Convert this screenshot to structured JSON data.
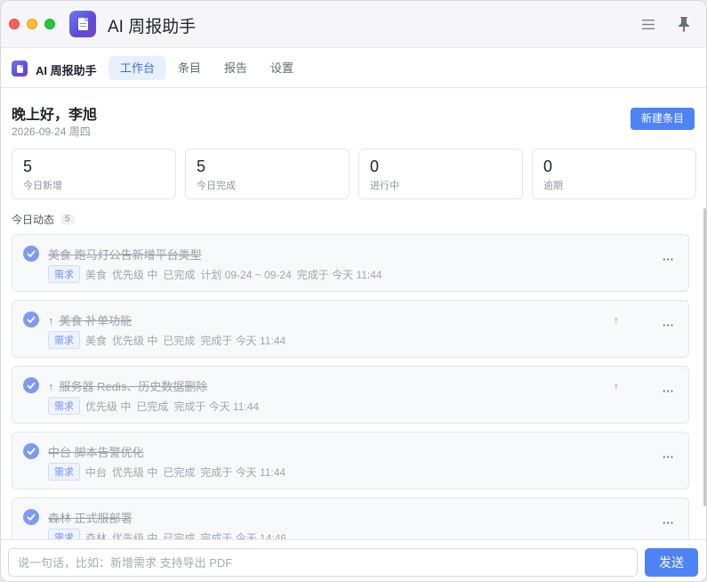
{
  "window": {
    "title": "AI 周报助手"
  },
  "nav": {
    "brand": "AI 周报助手",
    "tabs": [
      {
        "label": "工作台",
        "active": true
      },
      {
        "label": "条目",
        "active": false
      },
      {
        "label": "报告",
        "active": false
      },
      {
        "label": "设置",
        "active": false
      }
    ]
  },
  "header": {
    "greeting": "晚上好，李旭",
    "date": "2026-09-24 周四",
    "new_button": "新建条目"
  },
  "stats": [
    {
      "value": "5",
      "label": "今日新增"
    },
    {
      "value": "5",
      "label": "今日完成"
    },
    {
      "value": "0",
      "label": "进行中"
    },
    {
      "value": "0",
      "label": "逾期"
    }
  ],
  "feed": {
    "title": "今日动态",
    "count": "5",
    "items": [
      {
        "title": "美食 跑马灯公告新增平台类型",
        "arrow": "",
        "tag": "需求",
        "meta": [
          "美食",
          "优先级 中",
          "已完成",
          "计划 09-24 ~ 09-24",
          "完成于 今天 11:44"
        ],
        "pinned_up": false
      },
      {
        "title": "美食 补单功能",
        "arrow": "↑",
        "tag": "需求",
        "meta": [
          "美食",
          "优先级 中",
          "已完成",
          "完成于 今天 11:44"
        ],
        "pinned_up": true
      },
      {
        "title": "服务器 Redis、历史数据删除",
        "arrow": "↑",
        "tag": "需求",
        "meta": [
          "优先级 中",
          "已完成",
          "完成于 今天 11:44"
        ],
        "pinned_up": true
      },
      {
        "title": "中台 脚本告警优化",
        "arrow": "",
        "tag": "需求",
        "meta": [
          "中台",
          "优先级 中",
          "已完成",
          "完成于 今天 11:44"
        ],
        "pinned_up": false
      },
      {
        "title": "森林 正式服部署",
        "arrow": "",
        "tag": "需求",
        "meta": [
          "森林",
          "优先级 中",
          "已完成",
          "完成于 今天 14:46"
        ],
        "pinned_up": false
      }
    ],
    "more_glyph": "···",
    "up_glyph": "↑"
  },
  "composer": {
    "placeholder": "说一句话，比如：新增需求 支持导出 PDF",
    "value": "",
    "send_label": "发送"
  },
  "colors": {
    "accent": "#4e83f4",
    "check": "#7d9bef",
    "tag_bg": "#eef3fe"
  }
}
